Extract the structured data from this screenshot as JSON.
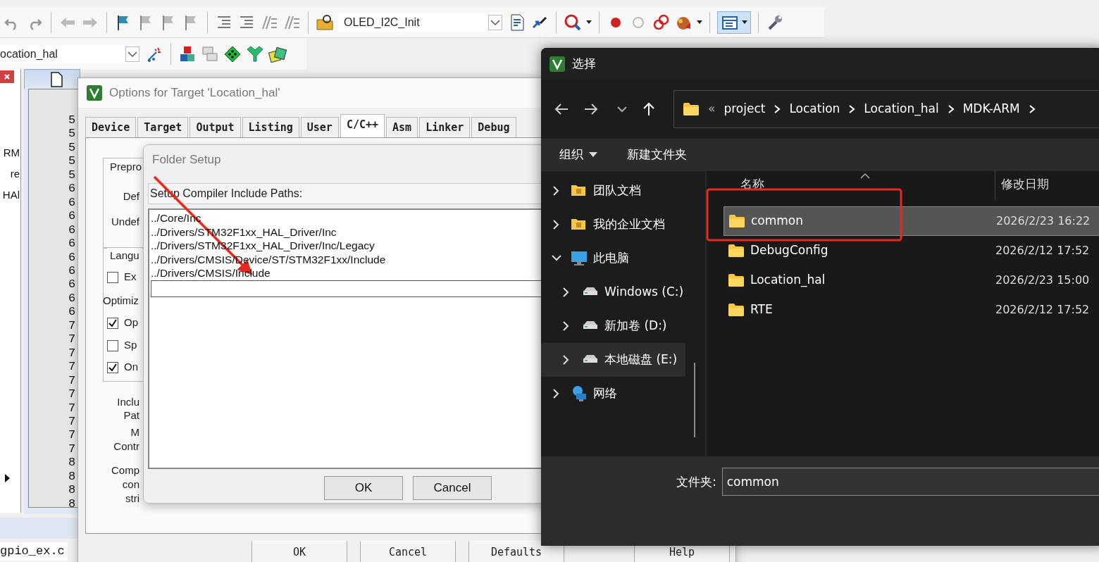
{
  "toolbar": {
    "function_combo": "OLED_I2C_Init",
    "target_combo": "ocation_hal"
  },
  "project_pane": {
    "items": [
      "RM",
      "re",
      "HAl"
    ]
  },
  "editor": {
    "line_numbers": [
      "5",
      "5",
      "5",
      "5",
      "5",
      "6",
      "6",
      "6",
      "6",
      "6",
      "6",
      "6",
      "6",
      "6",
      "6",
      "7",
      "7",
      "7",
      "7",
      "7",
      "7",
      "7",
      "7",
      "7",
      "7",
      "8",
      "8",
      "8",
      "8"
    ],
    "bottom_tab": "gpio_ex.c"
  },
  "options_dialog": {
    "title": "Options for Target 'Location_hal'",
    "tabs": [
      {
        "label": "Device",
        "selected": false
      },
      {
        "label": "Target",
        "selected": false
      },
      {
        "label": "Output",
        "selected": false
      },
      {
        "label": "Listing",
        "selected": false
      },
      {
        "label": "User",
        "selected": false
      },
      {
        "label": "C/C++",
        "selected": true
      },
      {
        "label": "Asm",
        "selected": false
      },
      {
        "label": "Linker",
        "selected": false
      },
      {
        "label": "Debug",
        "selected": false
      }
    ],
    "left_labels": [
      {
        "kind": "group",
        "text": "Prepro"
      },
      {
        "kind": "label",
        "text": "Def"
      },
      {
        "kind": "label",
        "text": "Undef"
      },
      {
        "kind": "group",
        "text": "Langu"
      },
      {
        "kind": "checkbox",
        "text": "Ex",
        "checked": false
      },
      {
        "kind": "label",
        "text": "Optimiz"
      },
      {
        "kind": "checkbox",
        "text": "Op",
        "checked": true
      },
      {
        "kind": "checkbox",
        "text": "Sp",
        "checked": false
      },
      {
        "kind": "checkbox",
        "text": "On",
        "checked": true
      },
      {
        "kind": "label",
        "text": "Inclu"
      },
      {
        "kind": "label",
        "text": "Pat"
      },
      {
        "kind": "label",
        "text": "M"
      },
      {
        "kind": "label",
        "text": "Contr"
      },
      {
        "kind": "label",
        "text": "Comp"
      },
      {
        "kind": "label",
        "text": "con"
      },
      {
        "kind": "label",
        "text": "stri"
      }
    ],
    "buttons": [
      "OK",
      "Cancel",
      "Defaults",
      "Help"
    ]
  },
  "folder_setup": {
    "title": "Folder Setup",
    "label": "Setup Compiler Include Paths:",
    "paths": [
      "../Core/Inc",
      "../Drivers/STM32F1xx_HAL_Driver/Inc",
      "../Drivers/STM32F1xx_HAL_Driver/Inc/Legacy",
      "../Drivers/CMSIS/Device/ST/STM32F1xx/Include",
      "../Drivers/CMSIS/Include"
    ],
    "buttons": [
      "OK",
      "Cancel"
    ]
  },
  "select_dialog": {
    "title": "选择",
    "address": {
      "overflow": "«",
      "parts": [
        "project",
        "Location",
        "Location_hal",
        "MDK-ARM"
      ]
    },
    "commands": [
      {
        "label": "组织",
        "dropdown": true
      },
      {
        "label": "新建文件夹",
        "dropdown": false
      }
    ],
    "nav": [
      {
        "label": "团队文档",
        "kind": "folder",
        "expanded": false,
        "selected": false
      },
      {
        "label": "我的企业文档",
        "kind": "folder",
        "expanded": false,
        "selected": false
      },
      {
        "label": "此电脑",
        "kind": "computer",
        "expanded": true,
        "selected": false,
        "children": [
          {
            "label": "Windows (C:)",
            "kind": "drive",
            "expanded": false,
            "selected": false
          },
          {
            "label": "新加卷 (D:)",
            "kind": "drive",
            "expanded": false,
            "selected": false
          },
          {
            "label": "本地磁盘 (E:)",
            "kind": "drive",
            "expanded": false,
            "selected": true
          }
        ]
      },
      {
        "label": "网络",
        "kind": "network",
        "expanded": false,
        "selected": false
      }
    ],
    "columns": [
      "名称",
      "修改日期"
    ],
    "files": [
      {
        "name": "common",
        "date": "2026/2/23 16:22",
        "selected": true
      },
      {
        "name": "DebugConfig",
        "date": "2026/2/12 17:52",
        "selected": false
      },
      {
        "name": "Location_hal",
        "date": "2026/2/23 15:00",
        "selected": false
      },
      {
        "name": "RTE",
        "date": "2026/2/12 17:52",
        "selected": false
      }
    ],
    "folder_label": "文件夹:",
    "folder_value": "common"
  }
}
